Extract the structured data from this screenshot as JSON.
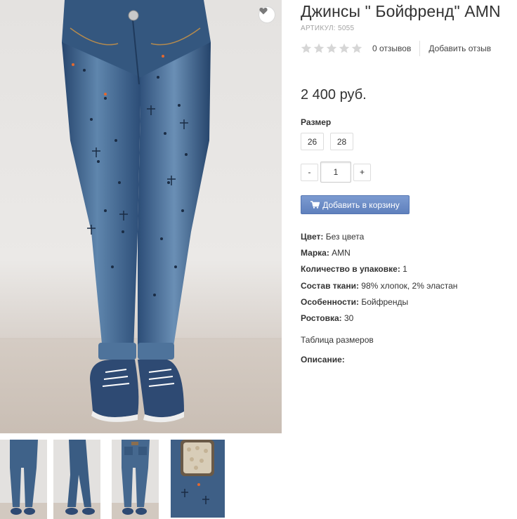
{
  "product": {
    "title": "Джинсы \" Бойфренд\" AMN",
    "sku": "АРТИКУЛ: 5055",
    "price": "2 400 руб."
  },
  "rating": {
    "stars_total": 5,
    "stars_filled": 0,
    "reviews_count": "0 отзывов",
    "add_review": "Добавить отзыв",
    "star_color": "#d6d6d6"
  },
  "size": {
    "label": "Размер",
    "options": [
      "26",
      "28"
    ]
  },
  "quantity": {
    "minus": "-",
    "value": "1",
    "plus": "+"
  },
  "cart": {
    "label": "Добавить в корзину",
    "icon": "cart-icon",
    "color": "#6b8ac6"
  },
  "specs": [
    {
      "key": "Цвет:",
      "value": " Без цвета"
    },
    {
      "key": "Марка:",
      "value": " AMN"
    },
    {
      "key": "Количество в упаковке:",
      "value": " 1"
    },
    {
      "key": "Состав ткани:",
      "value": " 98% хлопок, 2% эластан"
    },
    {
      "key": "Особенности:",
      "value": " Бойфренды"
    },
    {
      "key": "Ростовка:",
      "value": " 30"
    }
  ],
  "size_table_link": "Таблица размеров",
  "description_label": "Описание:",
  "gallery": {
    "wishlist_icon": "heart-icon",
    "denim_color": "#3d5f86",
    "thumbnails": [
      "front-view",
      "side-view",
      "back-view",
      "detail-view"
    ]
  }
}
